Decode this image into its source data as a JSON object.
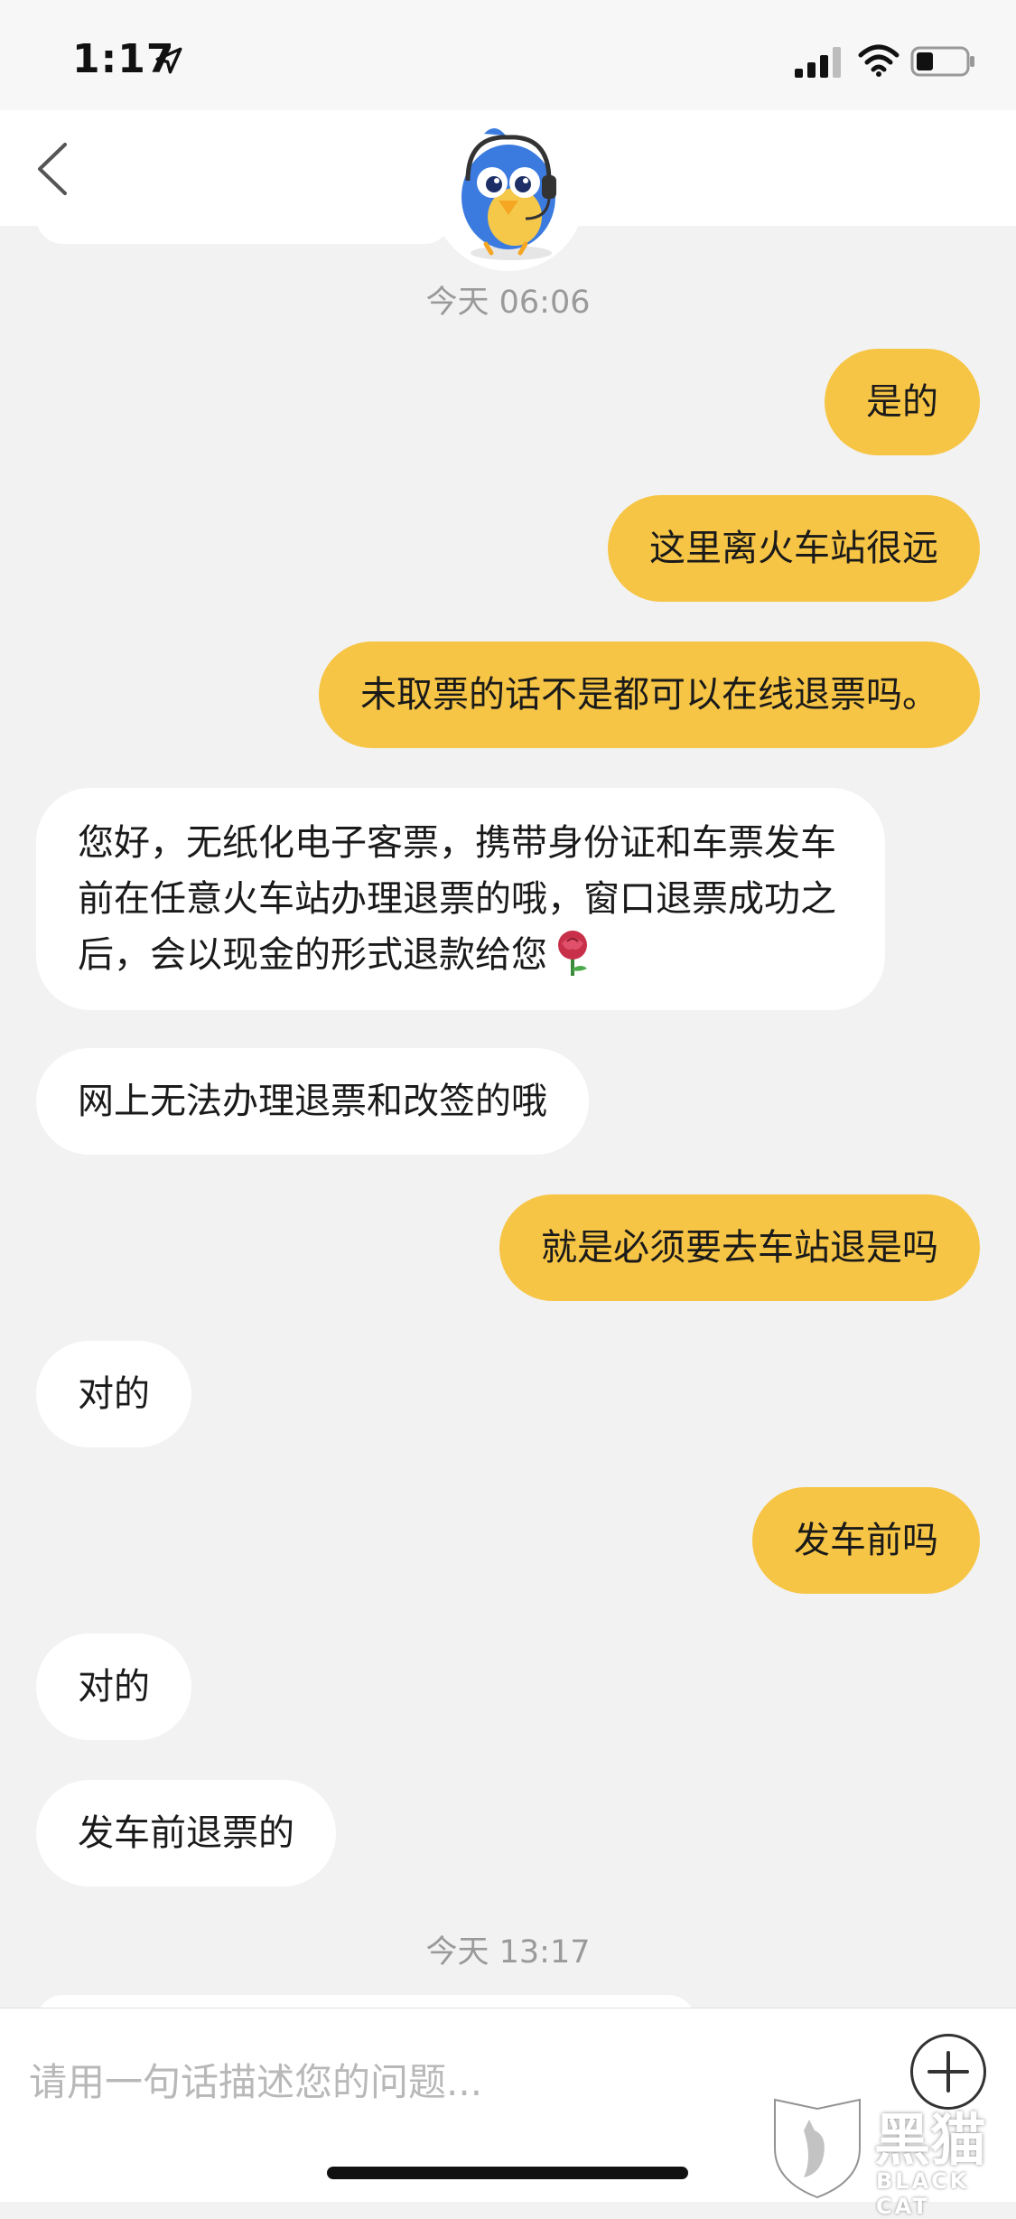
{
  "status_bar": {
    "time": "1:17"
  },
  "chat": {
    "timestamps": [
      "今天 06:06",
      "今天 13:17"
    ],
    "messages": [
      {
        "sender": "user",
        "text": "是的"
      },
      {
        "sender": "user",
        "text": "这里离火车站很远"
      },
      {
        "sender": "user",
        "text": "未取票的话不是都可以在线退票吗。"
      },
      {
        "sender": "agent",
        "text": "您好，无纸化电子客票，携带身份证和车票发车前在任意火车站办理退票的哦，窗口退票成功之后，会以现金的形式退款给您",
        "emoji": "rose-icon"
      },
      {
        "sender": "agent",
        "text": "网上无法办理退票和改签的哦"
      },
      {
        "sender": "user",
        "text": "就是必须要去车站退是吗"
      },
      {
        "sender": "agent",
        "text": "对的"
      },
      {
        "sender": "user",
        "text": "发车前吗"
      },
      {
        "sender": "agent",
        "text": "对的"
      },
      {
        "sender": "agent",
        "text": "发车前退票的"
      }
    ]
  },
  "input": {
    "placeholder": "请用一句话描述您的问题..."
  },
  "watermark": {
    "text": "黑猫",
    "sub": "BLACK CAT"
  },
  "colors": {
    "user_bubble": "#f7c545",
    "agent_bubble": "#ffffff",
    "background": "#f2f2f2"
  }
}
